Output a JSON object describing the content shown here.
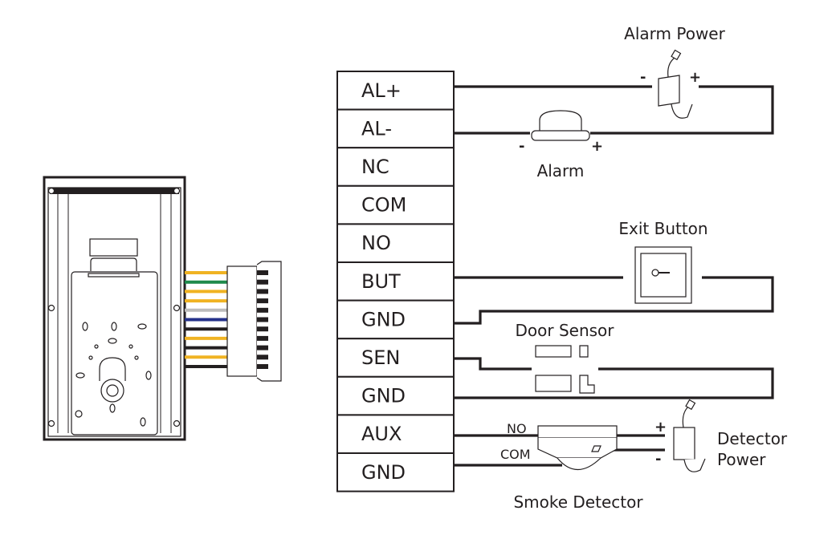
{
  "terminals": [
    "AL+",
    "AL-",
    "NC",
    "COM",
    "NO",
    "BUT",
    "GND",
    "SEN",
    "GND",
    "AUX",
    "GND"
  ],
  "wire_colors": [
    "#f0b323",
    "#1f8a4c",
    "#f0b323",
    "#f0b323",
    "#bdbdbd",
    "#24318a",
    "#231f20",
    "#f0b323",
    "#231f20",
    "#f0b323",
    "#231f20"
  ],
  "labels": {
    "alarm_power": "Alarm Power",
    "alarm": "Alarm",
    "exit_button": "Exit Button",
    "door_sensor": "Door Sensor",
    "smoke_detector": "Smoke Detector",
    "detector_power_1": "Detector",
    "detector_power_2": "Power",
    "no": "NO",
    "com": "COM",
    "minus": "-",
    "plus": "+"
  }
}
